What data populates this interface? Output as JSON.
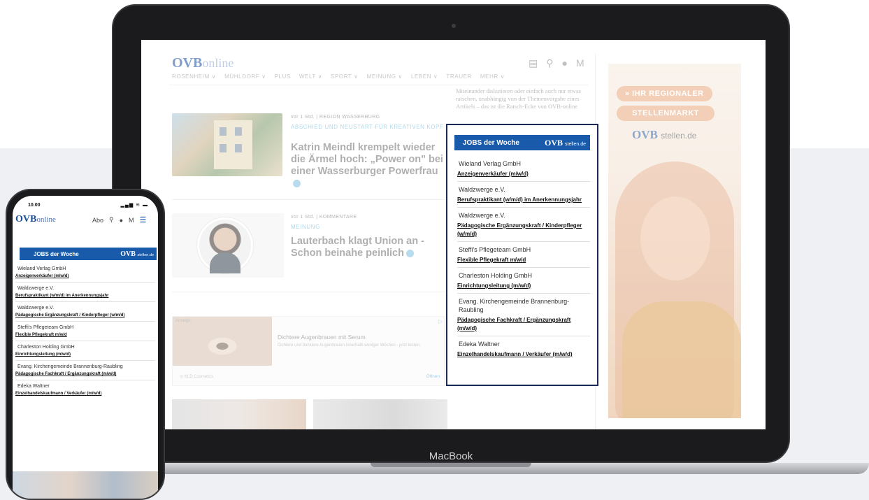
{
  "device": {
    "laptop_label": "MacBook"
  },
  "site": {
    "logo_bold": "OVB",
    "logo_rest": "online",
    "header_icons": [
      "newspaper-icon",
      "search-icon",
      "user-icon",
      "menu-icon"
    ],
    "header_icon_glyphs": [
      "▤",
      "⚲",
      "●",
      "M"
    ],
    "nav": [
      "ROSENHEIM ∨",
      "MÜHLDORF ∨",
      "PLUS",
      "WELT ∨",
      "SPORT ∨",
      "MEINUNG ∨",
      "LEBEN ∨",
      "TRAUER",
      "MEHR ∨"
    ],
    "intro": "Miteinander diskutieren oder einfach auch nur etwas ratschen, unabhängig von der Themenvorgabe eines Artikels – das ist die Ratsch-Ecke von OVB-online"
  },
  "articles": [
    {
      "meta": "vor 1 Std. | REGION WASSERBURG",
      "kicker": "ABSCHIED UND NEUSTART FÜR KREATIVEN KOPF",
      "headline": "Katrin Meindl krempelt wieder die Ärmel hoch: „Power on\" bei einer Wasserburger Powerfrau"
    },
    {
      "meta": "vor 1 Std. | KOMMENTARE",
      "kicker": "MEINUNG",
      "headline": "Lauterbach klagt Union an - Schon beinahe peinlich"
    }
  ],
  "ad": {
    "label": "Anzeige",
    "title": "Dichtere Augenbrauen mit Serum",
    "text": "Dichtere und dunklere Augenbrauen innerhalb weniger Wochen - jetzt testen.",
    "source": "KLD Cosmetics",
    "cta": "Öffnen"
  },
  "jobs": {
    "title": "JOBS der Woche",
    "brand_bold": "OVB",
    "brand_small": "stellen.de",
    "items": [
      {
        "company": "Wieland Verlag GmbH",
        "position": "Anzeigenverkäufer (m/w/d)"
      },
      {
        "company": "Waldzwerge e.V.",
        "position": "Berufspraktikant (w/m/d) im Anerkennungsjahr"
      },
      {
        "company": "Waldzwerge e.V.",
        "position": "Pädagogische Ergänzungskraft / Kinderpfleger (w/m/d)"
      },
      {
        "company": "Steffi's Pflegeteam GmbH",
        "position": "Flexible Pflegekraft m/w/d"
      },
      {
        "company": "Charleston Holding GmbH",
        "position": "Einrichtungsleitung (m/w/d)"
      },
      {
        "company": "Evang. Kirchengemeinde Brannenburg-Raubling",
        "position": "Pädagogische Fachkraft / Ergänzungskraft (m/w/d)"
      },
      {
        "company": "Edeka Waltner",
        "position": "Einzelhandelskaufmann / Verkäufer (m/w/d)"
      }
    ]
  },
  "stellenmarkt_ad": {
    "line1": "» IHR REGIONALER",
    "line2": "STELLENMARKT",
    "logo_bold": "OVB",
    "logo_small": "stellen.de"
  },
  "phone": {
    "time": "10.00",
    "status_icons": "▂▄▆ ≋ ▬",
    "abo": "Abo",
    "icon_glyphs": [
      "⚲",
      "●",
      "M",
      "☰"
    ]
  },
  "colors": {
    "brand_blue": "#1a5aab",
    "widget_border": "#1a2a55",
    "accent_orange": "#e9a87f"
  }
}
